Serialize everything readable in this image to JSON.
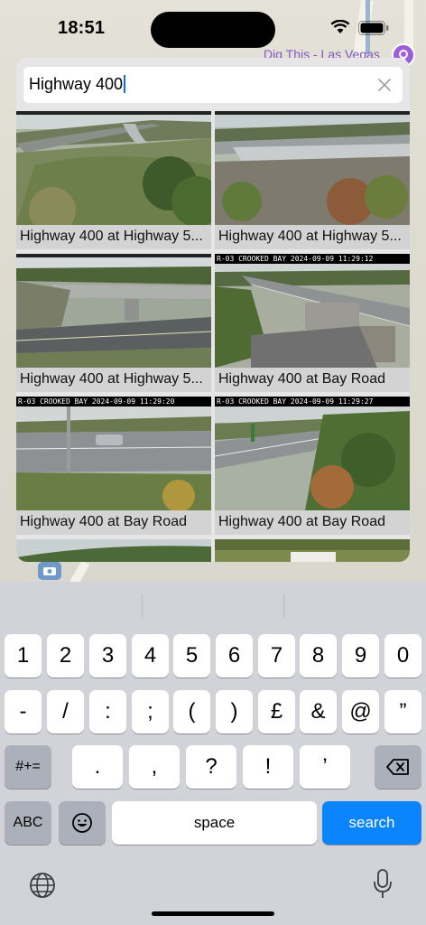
{
  "status_bar": {
    "time": "18:51"
  },
  "map": {
    "poi_label": "Dig This - Las Vegas"
  },
  "search": {
    "value": "Highway 400"
  },
  "results": [
    {
      "caption": "Highway 400 at Highway 5...",
      "stamp": ""
    },
    {
      "caption": "Highway 400 at Highway 5...",
      "stamp": ""
    },
    {
      "caption": "Highway 400 at Highway 5...",
      "stamp": ""
    },
    {
      "caption": "Highway 400 at Bay Road",
      "stamp": "R-03 CROOKED BAY 2024-09-09 11:29:12"
    },
    {
      "caption": "Highway 400 at Bay Road",
      "stamp": "R-03 CROOKED BAY 2024-09-09 11:29:20"
    },
    {
      "caption": "Highway 400 at Bay Road",
      "stamp": "R-03 CROOKED BAY 2024-09-09 11:29:27"
    }
  ],
  "keyboard": {
    "row1": [
      "1",
      "2",
      "3",
      "4",
      "5",
      "6",
      "7",
      "8",
      "9",
      "0"
    ],
    "row2": [
      "-",
      "/",
      ":",
      ";",
      "(",
      ")",
      "£",
      "&",
      "@",
      "”"
    ],
    "row3": [
      ".",
      ",",
      "?",
      "!",
      "’"
    ],
    "symbols_key": "#+=",
    "abc_key": "ABC",
    "space_key": "space",
    "search_key": "search"
  },
  "colors": {
    "accent": "#0a84ff",
    "poi": "#7e57c2"
  }
}
